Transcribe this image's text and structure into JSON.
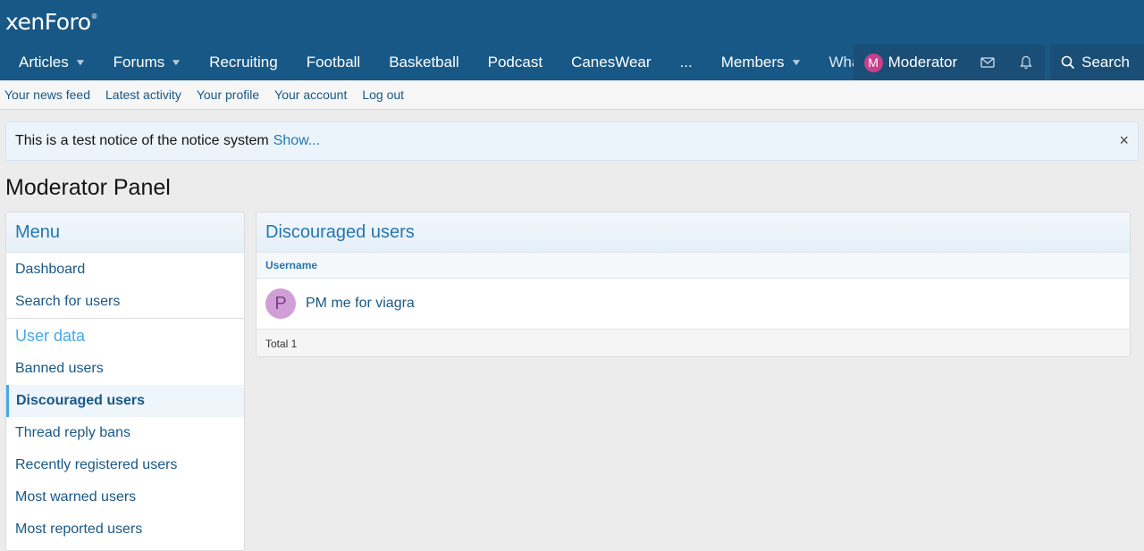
{
  "logo": {
    "text": "xenForo",
    "reg": "®"
  },
  "nav": {
    "tabs": [
      {
        "label": "Articles",
        "caret": true
      },
      {
        "label": "Forums",
        "caret": true
      },
      {
        "label": "Recruiting",
        "caret": false
      },
      {
        "label": "Football",
        "caret": false
      },
      {
        "label": "Basketball",
        "caret": false
      },
      {
        "label": "Podcast",
        "caret": false
      },
      {
        "label": "CanesWear",
        "caret": false
      },
      {
        "label": "...",
        "caret": false
      },
      {
        "label": "Members",
        "caret": true
      }
    ],
    "truncated": "Wha",
    "user": {
      "initial": "M",
      "name": "Moderator"
    },
    "search_label": "Search"
  },
  "subnav": [
    "Your news feed",
    "Latest activity",
    "Your profile",
    "Your account",
    "Log out"
  ],
  "notice": {
    "text": "This is a test notice of the notice system",
    "link": "Show...",
    "close": "×"
  },
  "page_title": "Moderator Panel",
  "sidebar": {
    "title": "Menu",
    "items_top": [
      "Dashboard",
      "Search for users"
    ],
    "section": "User data",
    "items": [
      "Banned users",
      "Discouraged users",
      "Thread reply bans",
      "Recently registered users",
      "Most warned users",
      "Most reported users"
    ],
    "active": "Discouraged users"
  },
  "main": {
    "title": "Discouraged users",
    "column": "Username",
    "rows": [
      {
        "initial": "P",
        "name": "PM me for viagra"
      }
    ],
    "footer": "Total 1"
  },
  "colors": {
    "header": "#185886",
    "accent": "#47a7eb",
    "link": "#185886"
  }
}
